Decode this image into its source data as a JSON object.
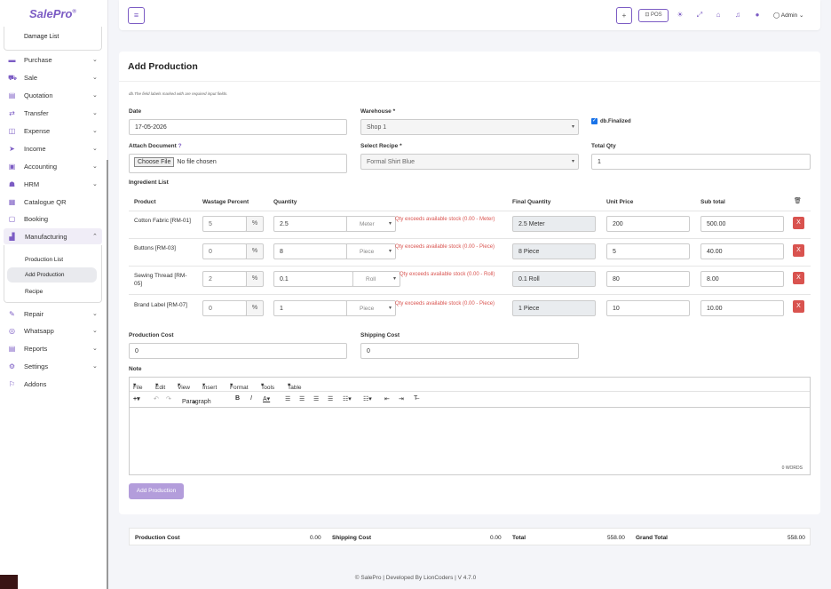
{
  "app": {
    "logo": "SalePro",
    "logo_mark": "®"
  },
  "sidebar": {
    "damage_list": "Damage List",
    "items": [
      {
        "label": "Purchase",
        "icon": "purchase-icon"
      },
      {
        "label": "Sale",
        "icon": "cart-icon"
      },
      {
        "label": "Quotation",
        "icon": "quotation-icon"
      },
      {
        "label": "Transfer",
        "icon": "transfer-icon"
      },
      {
        "label": "Expense",
        "icon": "expense-icon"
      },
      {
        "label": "Income",
        "icon": "income-icon"
      },
      {
        "label": "Accounting",
        "icon": "accounting-icon"
      },
      {
        "label": "HRM",
        "icon": "hrm-icon"
      },
      {
        "label": "Catalogue QR",
        "icon": "qr-icon"
      },
      {
        "label": "Booking",
        "icon": "booking-icon"
      },
      {
        "label": "Manufacturing",
        "icon": "chart-icon"
      },
      {
        "label": "Repair",
        "icon": "wrench-icon"
      },
      {
        "label": "Whatsapp",
        "icon": "whatsapp-icon"
      },
      {
        "label": "Reports",
        "icon": "reports-icon"
      },
      {
        "label": "Settings",
        "icon": "gear-icon"
      },
      {
        "label": "Addons",
        "icon": "addons-icon"
      }
    ],
    "manufacturing_sub": [
      "Production List",
      "Add Production",
      "Recipe"
    ]
  },
  "topbar": {
    "pos_label": "POS",
    "user": "Admin"
  },
  "form": {
    "title": "Add Production",
    "required_note": "db.The field labels marked with are required input fields.",
    "date_label": "Date",
    "date_value": "17-05-2026",
    "warehouse_label": "Warehouse *",
    "warehouse_value": "Shop 1",
    "finalized_label": "db.Finalized",
    "attach_label": "Attach Document",
    "choose_file": "Choose File",
    "no_file": "No file chosen",
    "recipe_label": "Select Recipe *",
    "recipe_value": "Formal Shirt Blue",
    "total_qty_label": "Total Qty",
    "total_qty_value": "1",
    "ingredient_list": "Ingredient List",
    "production_cost_label": "Production Cost",
    "production_cost_value": "0",
    "shipping_cost_label": "Shipping Cost",
    "shipping_cost_value": "0",
    "note_label": "Note",
    "submit": "Add Production"
  },
  "table": {
    "headers": [
      "Product",
      "Wastage Percent",
      "Quantity",
      "Final Quantity",
      "Unit Price",
      "Sub total"
    ],
    "rows": [
      {
        "product": "Cotton Fabric [RM-01]",
        "wastage": "5",
        "pct": "%",
        "qty": "2.5",
        "unit": "Meter",
        "error": "Qty exceeds available stock (0.00 - Meter)",
        "final": "2.5 Meter",
        "price": "200",
        "subtotal": "500.00",
        "del": "X"
      },
      {
        "product": "Buttons [RM-03]",
        "wastage": "0",
        "pct": "%",
        "qty": "8",
        "unit": "Piece",
        "error": "Qty exceeds available stock (0.00 - Piece)",
        "final": "8 Piece",
        "price": "5",
        "subtotal": "40.00",
        "del": "X"
      },
      {
        "product": "Sewing Thread [RM-05]",
        "wastage": "2",
        "pct": "%",
        "qty": "0.1",
        "unit": "Roll",
        "error": "Qty exceeds available stock (0.00 - Roll)",
        "final": "0.1 Roll",
        "price": "80",
        "subtotal": "8.00",
        "del": "X"
      },
      {
        "product": "Brand Label [RM-07]",
        "wastage": "0",
        "pct": "%",
        "qty": "1",
        "unit": "Piece",
        "error": "Qty exceeds available stock (0.00 - Piece)",
        "final": "1 Piece",
        "price": "10",
        "subtotal": "10.00",
        "del": "X"
      }
    ]
  },
  "editor": {
    "menu": [
      "File",
      "Edit",
      "View",
      "Insert",
      "Format",
      "Tools",
      "Table"
    ],
    "block_format": "Paragraph",
    "words": "0 WORDS"
  },
  "totals": {
    "production_cost_label": "Production Cost",
    "production_cost": "0.00",
    "shipping_cost_label": "Shipping Cost",
    "shipping_cost": "0.00",
    "total_label": "Total",
    "total": "558.00",
    "grand_total_label": "Grand Total",
    "grand_total": "558.00"
  },
  "footer": "© SalePro | Developed By LionCoders | V 4.7.0"
}
